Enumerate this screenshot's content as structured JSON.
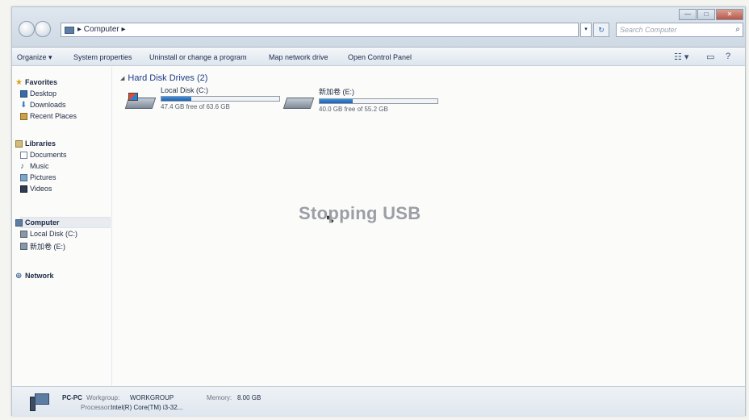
{
  "window": {
    "controls": {
      "minimize": "—",
      "maximize": "□",
      "close": "✕"
    }
  },
  "address": {
    "path": "▸ Computer ▸",
    "dropdown": "▾",
    "refresh": "↻",
    "search_placeholder": "Search Computer",
    "search_icon": "⌕"
  },
  "toolbar": {
    "organize": "Organize ▾",
    "system_properties": "System properties",
    "uninstall": "Uninstall or change a program",
    "map_network": "Map network drive",
    "control_panel": "Open Control Panel",
    "views_icon": "☷ ▾",
    "preview_icon": "▭",
    "help_icon": "?"
  },
  "nav": {
    "favorites": "Favorites",
    "desktop": "Desktop",
    "downloads": "Downloads",
    "recent": "Recent Places",
    "libraries": "Libraries",
    "documents": "Documents",
    "music": "Music",
    "pictures": "Pictures",
    "videos": "Videos",
    "computer": "Computer",
    "local_disk": "Local Disk (C:)",
    "usb_drive": "新加卷 (E:)",
    "network": "Network"
  },
  "content": {
    "section_title": "Hard Disk Drives (2)",
    "drives": [
      {
        "name": "Local Disk (C:)",
        "free": "47.4 GB free of 63.6 GB",
        "used_fraction": 0.25
      },
      {
        "name": "新加卷 (E:)",
        "free": "40.0 GB free of 55.2 GB",
        "used_fraction": 0.28
      }
    ],
    "overlay_text": "Stopping USB"
  },
  "details": {
    "pc_name": "PC-PC",
    "workgroup_label": "Workgroup:",
    "workgroup_value": "WORKGROUP",
    "memory_label": "Memory:",
    "memory_value": "8.00 GB",
    "processor_label": "Processor:",
    "processor_value": "Intel(R) Core(TM) i3-32..."
  }
}
